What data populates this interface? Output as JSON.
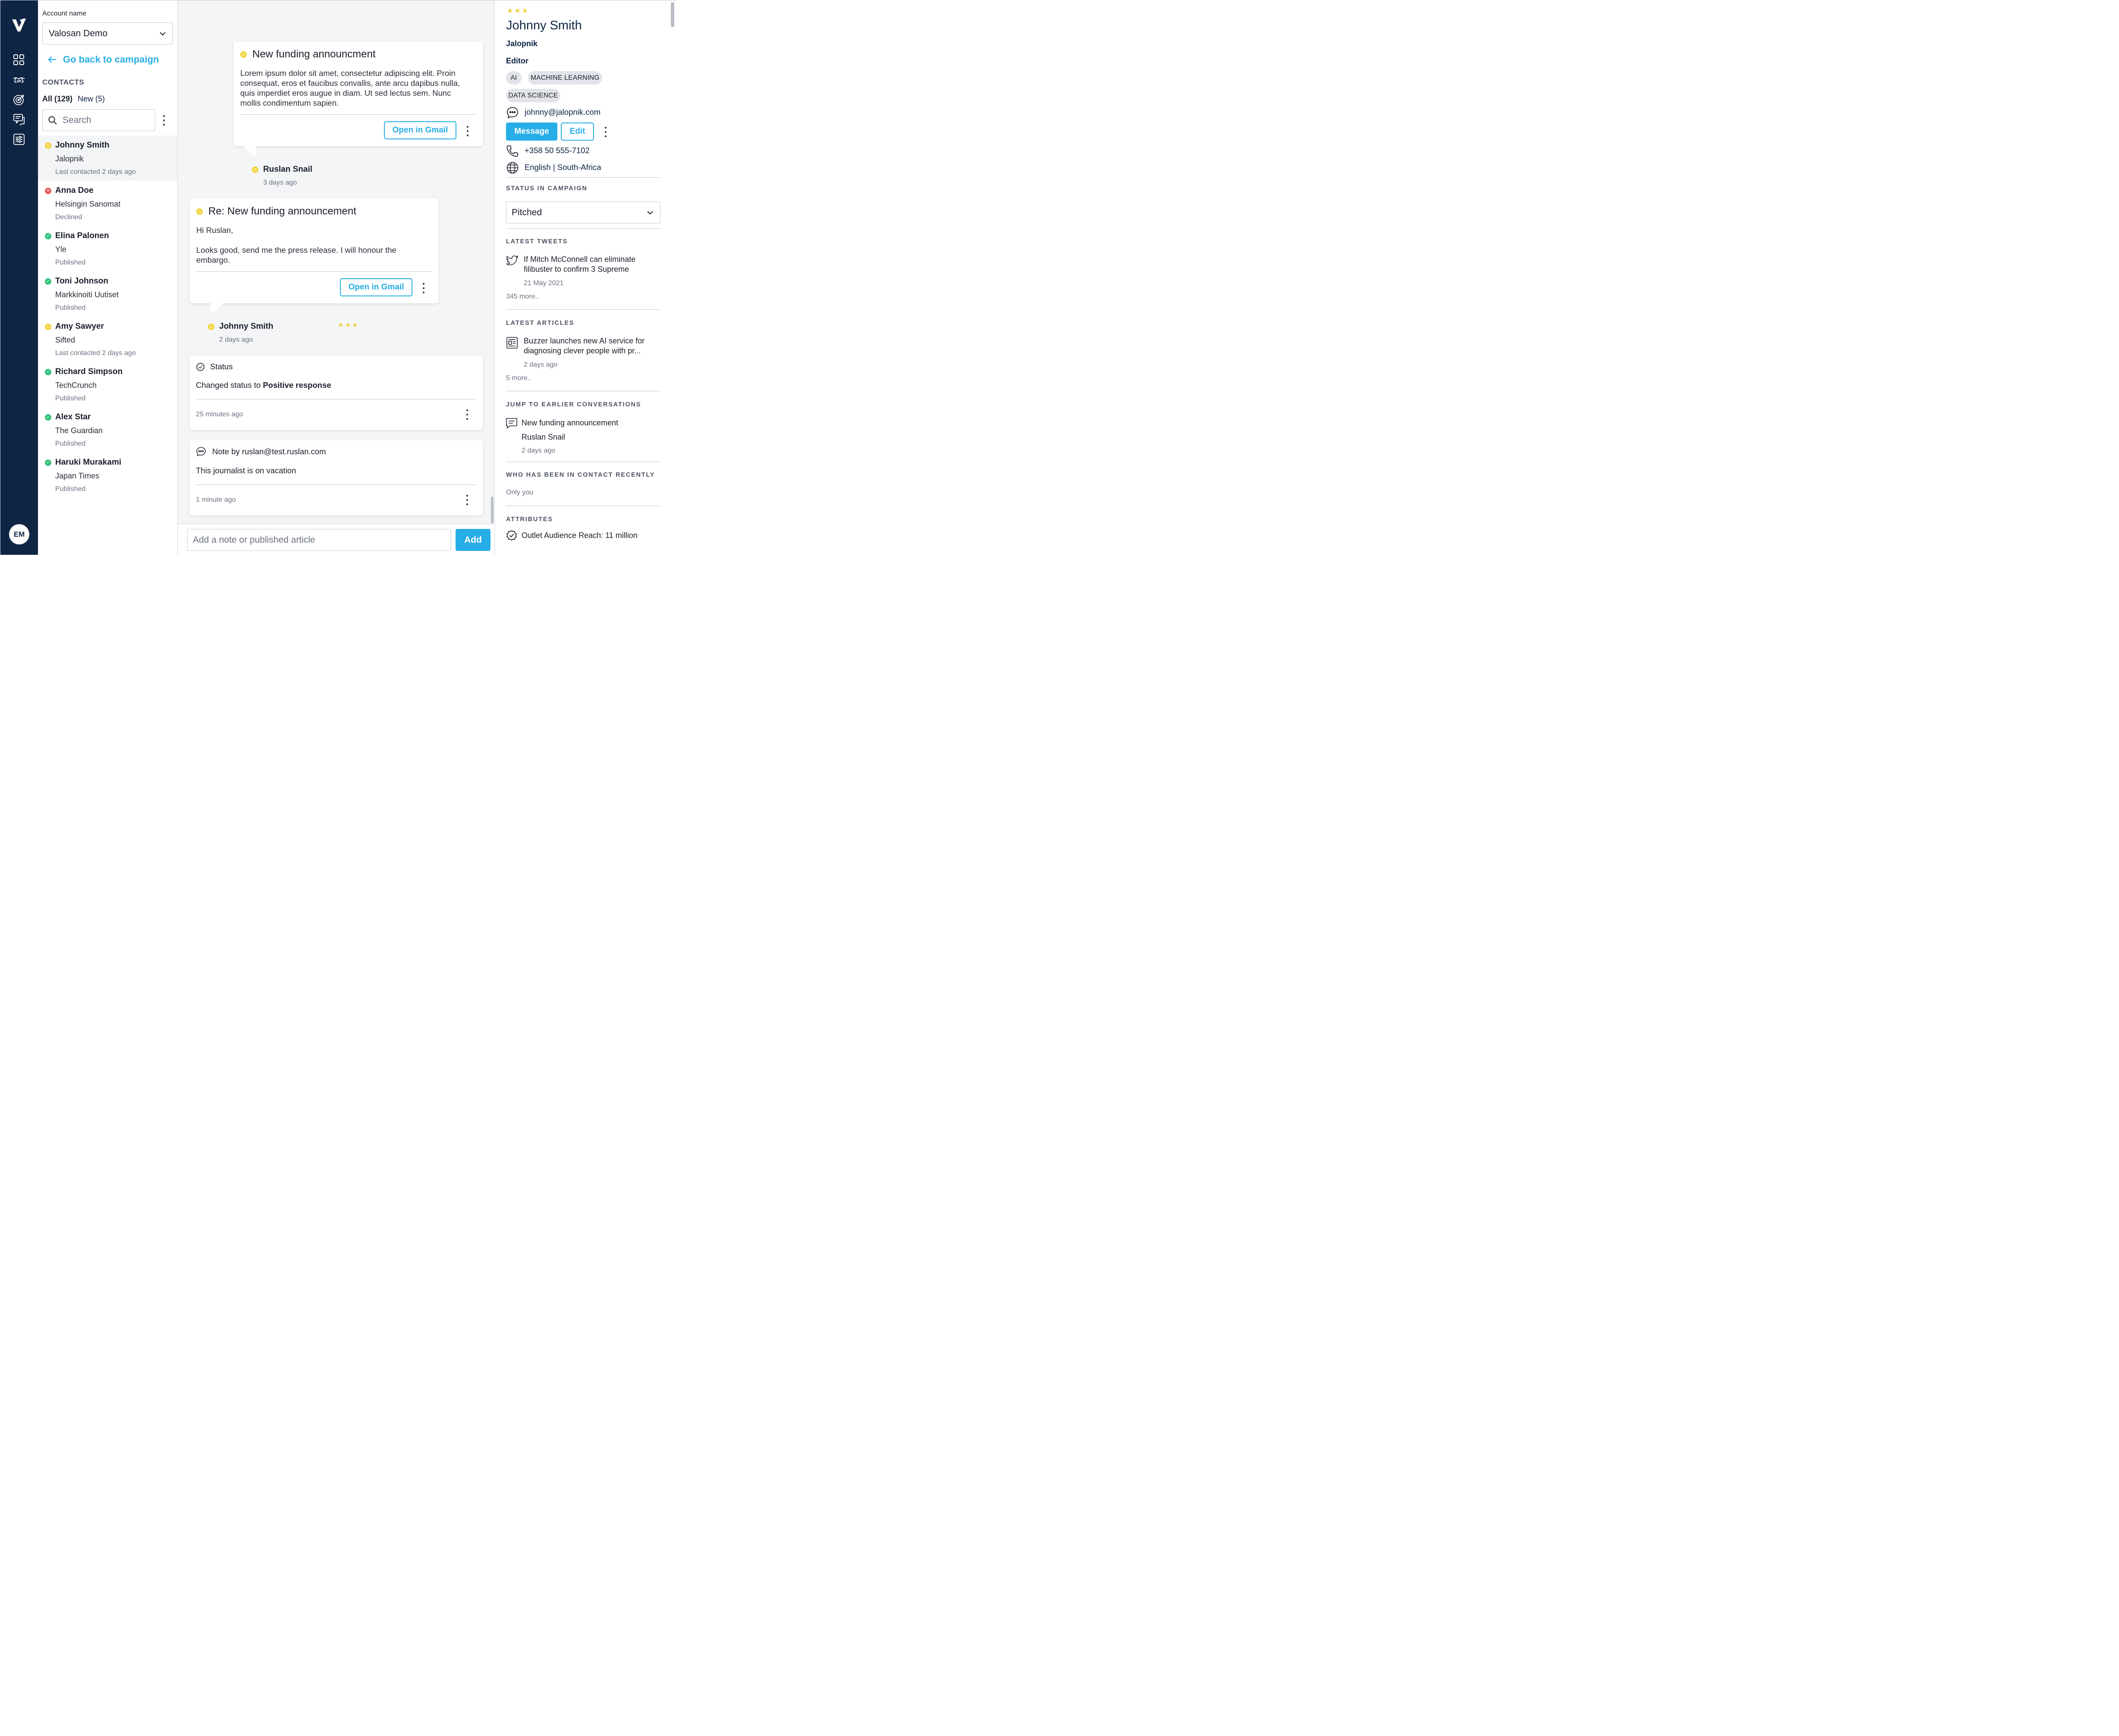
{
  "nav": {
    "logo": "V",
    "items": [
      "grid-icon",
      "handshake-icon",
      "target-icon",
      "chat-list-icon",
      "settings-list-icon"
    ],
    "avatar_initials": "EM"
  },
  "contacts_panel": {
    "account_label": "Account name",
    "account_value": "Valosan Demo",
    "back_link": "Go back to campaign",
    "heading": "CONTACTS",
    "filter_all": "All (129)",
    "filter_new": "New (5)",
    "search_placeholder": "Search",
    "items": [
      {
        "name": "Johnny Smith",
        "outlet": "Jalopnik",
        "status": "Last contacted 2 days ago",
        "state": "yellow"
      },
      {
        "name": "Anna Doe",
        "outlet": "Helsingin Sanomat",
        "status": "Declined",
        "state": "red"
      },
      {
        "name": "Elina Palonen",
        "outlet": "Yle",
        "status": "Published",
        "state": "green"
      },
      {
        "name": "Toni Johnson",
        "outlet": "Markkinoiti Uutiset",
        "status": "Published",
        "state": "green"
      },
      {
        "name": "Amy Sawyer",
        "outlet": "Sifted",
        "status": "Last contacted 2 days ago",
        "state": "yellow"
      },
      {
        "name": "Richard Simpson",
        "outlet": "TechCrunch",
        "status": "Published",
        "state": "green"
      },
      {
        "name": "Alex Star",
        "outlet": "The Guardian",
        "status": "Published",
        "state": "green"
      },
      {
        "name": "Haruki Murakami",
        "outlet": "Japan Times",
        "status": "Published",
        "state": "green"
      }
    ]
  },
  "timeline": {
    "message1": {
      "title": "New funding announcment",
      "body": "Lorem ipsum dolor sit amet, consectetur adipiscing elit. Proin consequat, eros et faucibus convallis, ante arcu dapibus nulla, quis imperdiet eros augue in diam. Ut sed lectus sem. Nunc mollis condimentum sapien.",
      "button": "Open in Gmail",
      "sender": "Ruslan Snail",
      "time": "3 days ago"
    },
    "message2": {
      "title": "Re: New funding announcement",
      "body_line1": "Hi Ruslan,",
      "body_line2": "Looks good, send me the press release. I will honour the embargo.",
      "button": "Open in Gmail",
      "sender": "Johnny Smith",
      "stars": "★★★",
      "time": "2 days ago"
    },
    "status_event": {
      "label": "Status",
      "text_prefix": "Changed status to ",
      "text_value": "Positive response",
      "time": "25 minutes ago"
    },
    "note_event": {
      "label": "Note by ruslan@test.ruslan.com",
      "text": "This journalist is on vacation",
      "time": "1 minute ago"
    },
    "composer_placeholder": "Add a note or published article",
    "composer_button": "Add"
  },
  "profile": {
    "stars": "★★★",
    "name": "Johnny Smith",
    "outlet": "Jalopnik",
    "role": "Editor",
    "tags": [
      "AI",
      "MACHINE LEARNING",
      "DATA SCIENCE"
    ],
    "email": "johnny@jalopnik.com",
    "message_button": "Message",
    "edit_button": "Edit",
    "phone": "+358 50 555-7102",
    "locale": "English | South-Africa",
    "status_heading": "STATUS IN CAMPAIGN",
    "status_value": "Pitched",
    "tweets_heading": "LATEST TWEETS",
    "tweet_text": "If Mitch McConnell can eliminate filibuster to confirm 3 Supreme",
    "tweet_date": "21 May 2021",
    "tweets_more": "345 more..",
    "articles_heading": "LATEST ARTICLES",
    "article_text": "Buzzer launches new AI service for diagnosing clever people with pr...",
    "article_date": "2 days ago",
    "articles_more": "5 more..",
    "earlier_heading": "JUMP TO EARLIER CONVERSATIONS",
    "earlier_title": "New funding announcement",
    "earlier_sender": "Ruslan Snail",
    "earlier_time": "2 days ago",
    "contact_heading": "WHO HAS BEEN IN CONTACT RECENTLY",
    "contact_value": "Only you",
    "attributes_heading": "ATTRIBUTES",
    "attribute_text": "Outlet Audience Reach: 11 million"
  },
  "colors": {
    "navy": "#0f2544",
    "accent": "#27aee6",
    "yellow": "#f2d233",
    "red": "#e65b5b",
    "green": "#33c27c"
  }
}
